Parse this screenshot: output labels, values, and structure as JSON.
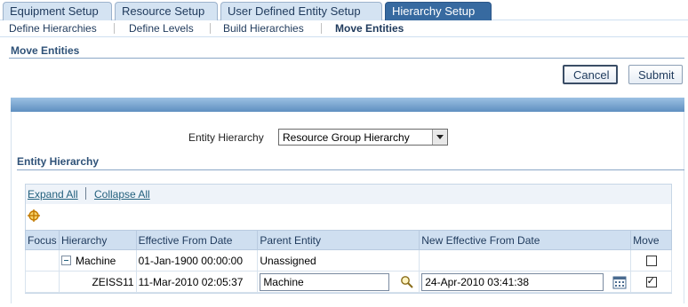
{
  "tabs": [
    {
      "label": "Equipment Setup"
    },
    {
      "label": "Resource Setup"
    },
    {
      "label": "User Defined Entity Setup"
    },
    {
      "label": "Hierarchy Setup"
    }
  ],
  "subnav": [
    {
      "label": "Define Hierarchies"
    },
    {
      "label": "Define Levels"
    },
    {
      "label": "Build Hierarchies"
    },
    {
      "label": "Move Entities"
    }
  ],
  "page": {
    "title": "Move Entities",
    "cancel_label": "Cancel",
    "submit_label": "Submit"
  },
  "entity_hierarchy_field": {
    "label": "Entity Hierarchy",
    "selected": "Resource Group Hierarchy"
  },
  "section": {
    "title": "Entity Hierarchy",
    "expand_all": "Expand All",
    "collapse_all": "Collapse All"
  },
  "table": {
    "columns": [
      "Focus",
      "Hierarchy",
      "Effective From Date",
      "Parent Entity",
      "New Effective From Date",
      "Move"
    ],
    "rows": [
      {
        "hierarchy": "Machine",
        "effective_from": "01-Jan-1900 00:00:00",
        "parent": "Unassigned",
        "new_effective": "",
        "move": false
      },
      {
        "hierarchy": "ZEISS11",
        "effective_from": "11-Mar-2010 02:05:37",
        "parent": "Machine",
        "new_effective": "24-Apr-2010 03:41:38",
        "move": true
      }
    ]
  },
  "colors": {
    "active_tab": "#376aa0",
    "tab_bg": "#d4e3f2",
    "header_row": "#cfdff0",
    "link": "#23607d"
  }
}
